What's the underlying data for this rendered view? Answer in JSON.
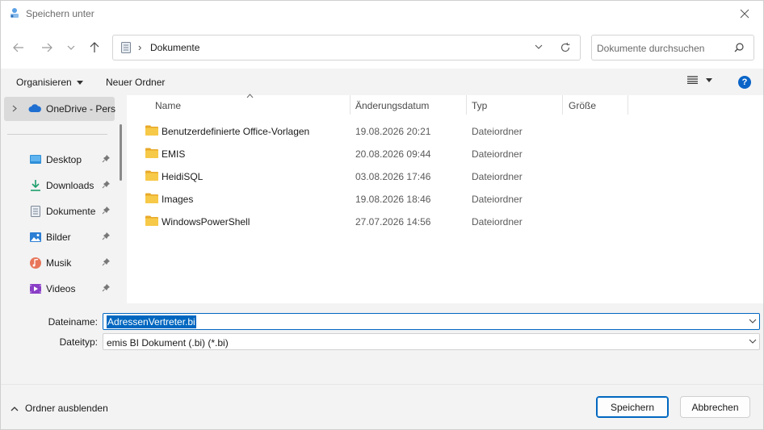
{
  "window": {
    "title": "Speichern unter"
  },
  "address": {
    "location": "Dokumente",
    "separator": "›"
  },
  "search": {
    "placeholder": "Dokumente durchsuchen"
  },
  "toolbar": {
    "organize_label": "Organisieren",
    "new_folder_label": "Neuer Ordner"
  },
  "sidebar": {
    "onedrive_label": "OneDrive - Perso",
    "items": [
      {
        "label": "Desktop",
        "icon": "desktop-icon"
      },
      {
        "label": "Downloads",
        "icon": "download-icon"
      },
      {
        "label": "Dokumente",
        "icon": "document-icon"
      },
      {
        "label": "Bilder",
        "icon": "pictures-icon"
      },
      {
        "label": "Musik",
        "icon": "music-icon"
      },
      {
        "label": "Videos",
        "icon": "videos-icon"
      }
    ]
  },
  "columns": {
    "name": "Name",
    "date": "Änderungsdatum",
    "type": "Typ",
    "size": "Größe"
  },
  "files": [
    {
      "name": "Benutzerdefinierte Office-Vorlagen",
      "date": "19.08.2026 20:21",
      "type": "Dateiordner"
    },
    {
      "name": "EMIS",
      "date": "20.08.2026 09:44",
      "type": "Dateiordner"
    },
    {
      "name": "HeidiSQL",
      "date": "03.08.2026 17:46",
      "type": "Dateiordner"
    },
    {
      "name": "Images",
      "date": "19.08.2026 18:46",
      "type": "Dateiordner"
    },
    {
      "name": "WindowsPowerShell",
      "date": "27.07.2026 14:56",
      "type": "Dateiordner"
    }
  ],
  "form": {
    "filename_label": "Dateiname:",
    "filename_value": "AdressenVertreter.bi",
    "filetype_label": "Dateityp:",
    "filetype_value": "emis BI Dokument (.bi) (*.bi)"
  },
  "footer": {
    "hide_folders_label": "Ordner ausblenden",
    "save_label": "Speichern",
    "cancel_label": "Abbrechen"
  },
  "colors": {
    "accent": "#0067c0",
    "folder": "#f2c14e",
    "help": "#0a64c8"
  }
}
